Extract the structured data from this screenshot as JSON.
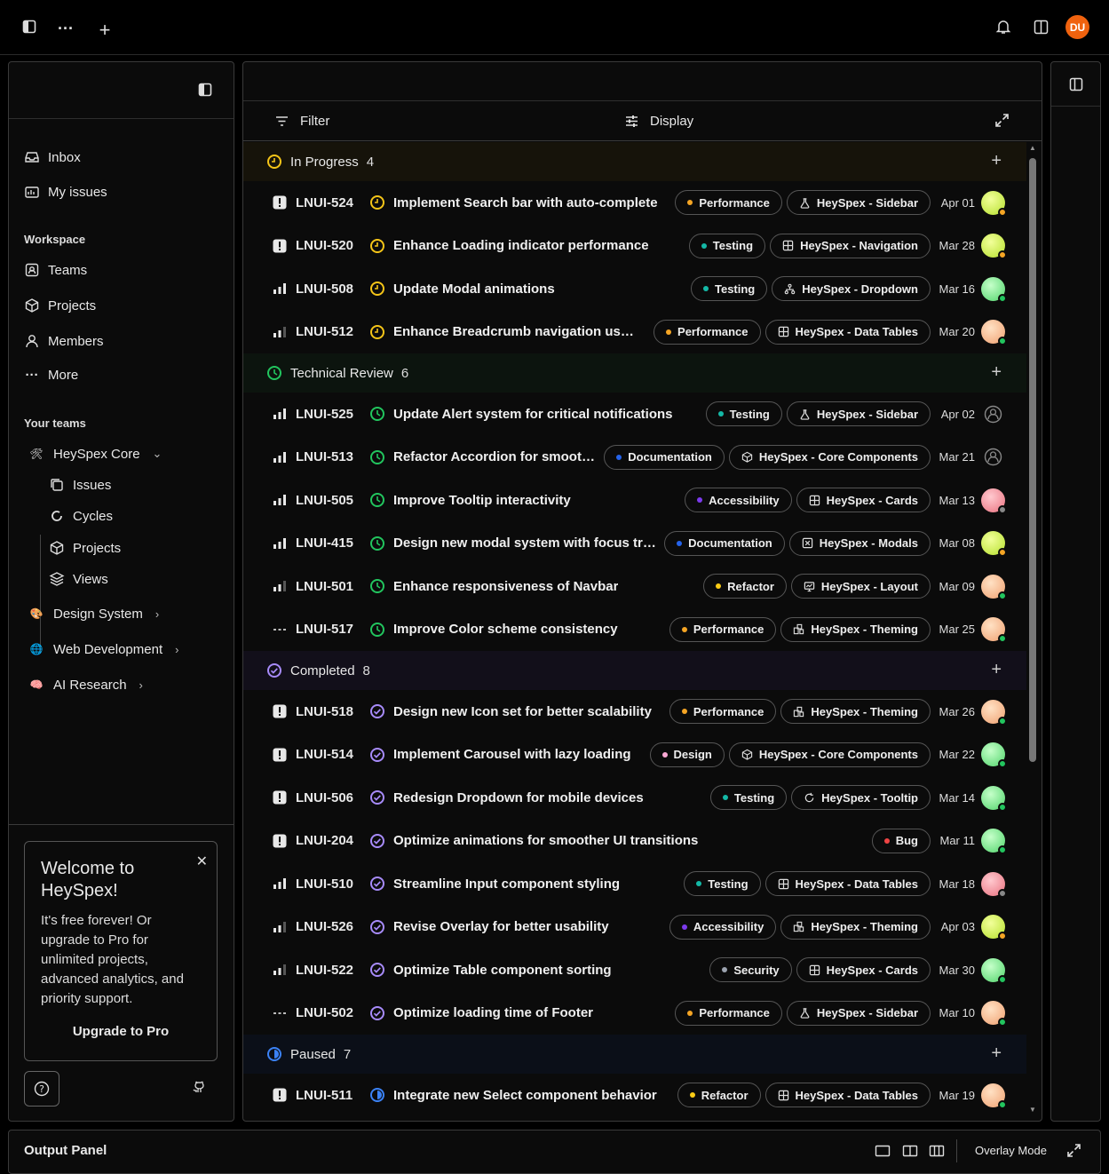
{
  "topbar": {
    "avatar_initials": "DU"
  },
  "sidebar": {
    "nav": [
      {
        "label": "Inbox",
        "icon": "inbox-icon"
      },
      {
        "label": "My issues",
        "icon": "my-issues-icon"
      }
    ],
    "workspace_label": "Workspace",
    "workspace": [
      {
        "label": "Teams",
        "icon": "teams-icon"
      },
      {
        "label": "Projects",
        "icon": "projects-icon"
      },
      {
        "label": "Members",
        "icon": "members-icon"
      },
      {
        "label": "More",
        "icon": "more-icon"
      }
    ],
    "your_teams_label": "Your teams",
    "teams": [
      {
        "label": "HeySpex Core",
        "emoji": "🛠",
        "expanded": true
      },
      {
        "label": "Design System",
        "emoji": "🎨",
        "expanded": false
      },
      {
        "label": "Web Development",
        "emoji": "🌐",
        "expanded": false
      },
      {
        "label": "AI Research",
        "emoji": "🧠",
        "expanded": false
      }
    ],
    "team_subitems": [
      {
        "label": "Issues",
        "icon": "issues-icon"
      },
      {
        "label": "Cycles",
        "icon": "cycles-icon"
      },
      {
        "label": "Projects",
        "icon": "projects-icon"
      },
      {
        "label": "Views",
        "icon": "views-icon"
      }
    ],
    "welcome": {
      "title": "Welcome to HeySpex!",
      "body": "It's free forever! Or upgrade to Pro for unlimited projects, advanced analytics, and priority support.",
      "cta": "Upgrade to Pro"
    }
  },
  "toolbar": {
    "filter": "Filter",
    "display": "Display"
  },
  "groups": [
    {
      "name": "In Progress",
      "count": "4",
      "status": "in-progress",
      "color": "#f5c518",
      "issues": [
        {
          "priority": "urgent",
          "id": "LNUI-524",
          "title": "Implement Search bar with auto-complete",
          "label": "Performance",
          "label_color": "#f5a524",
          "project": "HeySpex - Sidebar",
          "project_icon": "flask",
          "date": "Apr 01",
          "avatar": "lime",
          "presence": "#f5a524"
        },
        {
          "priority": "urgent",
          "id": "LNUI-520",
          "title": "Enhance Loading indicator performance",
          "label": "Testing",
          "label_color": "#14b8a6",
          "project": "HeySpex - Navigation",
          "project_icon": "grid",
          "date": "Mar 28",
          "avatar": "lime",
          "presence": "#f5a524"
        },
        {
          "priority": "high",
          "id": "LNUI-508",
          "title": "Update Modal animations",
          "label": "Testing",
          "label_color": "#14b8a6",
          "project": "HeySpex - Dropdown",
          "project_icon": "tree",
          "date": "Mar 16",
          "avatar": "green",
          "presence": "#22c55e"
        },
        {
          "priority": "medium",
          "id": "LNUI-512",
          "title": "Enhance Breadcrumb navigation usabi...",
          "label": "Performance",
          "label_color": "#f5a524",
          "project": "HeySpex - Data Tables",
          "project_icon": "grid",
          "date": "Mar 20",
          "avatar": "peach",
          "presence": "#22c55e"
        }
      ]
    },
    {
      "name": "Technical Review",
      "count": "6",
      "status": "review",
      "color": "#22c55e",
      "issues": [
        {
          "priority": "high",
          "id": "LNUI-525",
          "title": "Update Alert system for critical notifications",
          "label": "Testing",
          "label_color": "#14b8a6",
          "project": "HeySpex - Sidebar",
          "project_icon": "flask",
          "date": "Apr 02",
          "avatar": "none",
          "presence": ""
        },
        {
          "priority": "high",
          "id": "LNUI-513",
          "title": "Refactor Accordion for smooth...",
          "label": "Documentation",
          "label_color": "#2563eb",
          "project": "HeySpex - Core Components",
          "project_icon": "box",
          "date": "Mar 21",
          "avatar": "none",
          "presence": ""
        },
        {
          "priority": "high",
          "id": "LNUI-505",
          "title": "Improve Tooltip interactivity",
          "label": "Accessibility",
          "label_color": "#7c3aed",
          "project": "HeySpex - Cards",
          "project_icon": "grid",
          "date": "Mar 13",
          "avatar": "pink",
          "presence": "#888888"
        },
        {
          "priority": "high",
          "id": "LNUI-415",
          "title": "Design new modal system with focus tra...",
          "label": "Documentation",
          "label_color": "#2563eb",
          "project": "HeySpex - Modals",
          "project_icon": "xbox",
          "date": "Mar 08",
          "avatar": "lime",
          "presence": "#f5a524"
        },
        {
          "priority": "medium",
          "id": "LNUI-501",
          "title": "Enhance responsiveness of Navbar",
          "label": "Refactor",
          "label_color": "#facc15",
          "project": "HeySpex - Layout",
          "project_icon": "monitor",
          "date": "Mar 09",
          "avatar": "peach",
          "presence": "#22c55e"
        },
        {
          "priority": "none",
          "id": "LNUI-517",
          "title": "Improve Color scheme consistency",
          "label": "Performance",
          "label_color": "#f5a524",
          "project": "HeySpex - Theming",
          "project_icon": "swatch",
          "date": "Mar 25",
          "avatar": "peach",
          "presence": "#22c55e"
        }
      ]
    },
    {
      "name": "Completed",
      "count": "8",
      "status": "completed",
      "color": "#a78bfa",
      "issues": [
        {
          "priority": "urgent",
          "id": "LNUI-518",
          "title": "Design new Icon set for better scalability",
          "label": "Performance",
          "label_color": "#f5a524",
          "project": "HeySpex - Theming",
          "project_icon": "swatch",
          "date": "Mar 26",
          "avatar": "peach",
          "presence": "#22c55e"
        },
        {
          "priority": "urgent",
          "id": "LNUI-514",
          "title": "Implement Carousel with lazy loading",
          "label": "Design",
          "label_color": "#f9a8d4",
          "project": "HeySpex - Core Components",
          "project_icon": "box",
          "date": "Mar 22",
          "avatar": "green",
          "presence": "#22c55e"
        },
        {
          "priority": "urgent",
          "id": "LNUI-506",
          "title": "Redesign Dropdown for mobile devices",
          "label": "Testing",
          "label_color": "#14b8a6",
          "project": "HeySpex - Tooltip",
          "project_icon": "refresh",
          "date": "Mar 14",
          "avatar": "green",
          "presence": "#22c55e"
        },
        {
          "priority": "urgent",
          "id": "LNUI-204",
          "title": "Optimize animations for smoother UI transitions",
          "label": "Bug",
          "label_color": "#ef4444",
          "project": "",
          "project_icon": "",
          "date": "Mar 11",
          "avatar": "green",
          "presence": "#22c55e"
        },
        {
          "priority": "high",
          "id": "LNUI-510",
          "title": "Streamline Input component styling",
          "label": "Testing",
          "label_color": "#14b8a6",
          "project": "HeySpex - Data Tables",
          "project_icon": "grid",
          "date": "Mar 18",
          "avatar": "pink",
          "presence": "#888888"
        },
        {
          "priority": "medium",
          "id": "LNUI-526",
          "title": "Revise Overlay for better usability",
          "label": "Accessibility",
          "label_color": "#7c3aed",
          "project": "HeySpex - Theming",
          "project_icon": "swatch",
          "date": "Apr 03",
          "avatar": "lime",
          "presence": "#f5a524"
        },
        {
          "priority": "medium",
          "id": "LNUI-522",
          "title": "Optimize Table component sorting",
          "label": "Security",
          "label_color": "#9ca3af",
          "project": "HeySpex - Cards",
          "project_icon": "grid",
          "date": "Mar 30",
          "avatar": "green",
          "presence": "#22c55e"
        },
        {
          "priority": "none",
          "id": "LNUI-502",
          "title": "Optimize loading time of Footer",
          "label": "Performance",
          "label_color": "#f5a524",
          "project": "HeySpex - Sidebar",
          "project_icon": "flask",
          "date": "Mar 10",
          "avatar": "peach",
          "presence": "#22c55e"
        }
      ]
    },
    {
      "name": "Paused",
      "count": "7",
      "status": "paused",
      "color": "#3b82f6",
      "issues": [
        {
          "priority": "urgent",
          "id": "LNUI-511",
          "title": "Integrate new Select component behavior",
          "label": "Refactor",
          "label_color": "#facc15",
          "project": "HeySpex - Data Tables",
          "project_icon": "grid",
          "date": "Mar 19",
          "avatar": "peach",
          "presence": "#22c55e"
        }
      ]
    }
  ],
  "output_panel": {
    "title": "Output Panel",
    "mode": "Overlay Mode"
  }
}
